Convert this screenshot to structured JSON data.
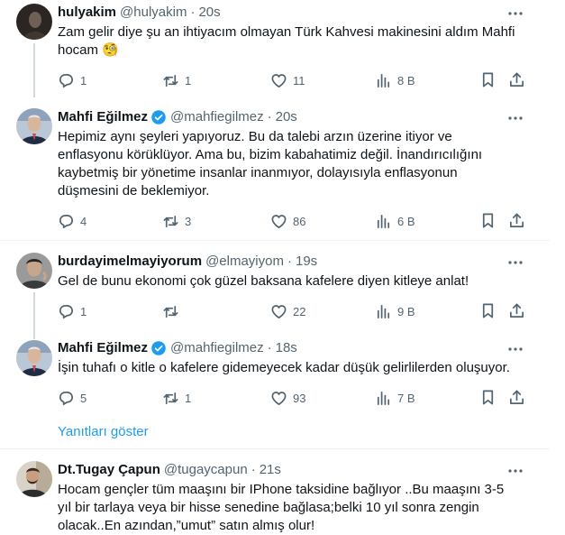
{
  "colors": {
    "accent": "#1d9bf0",
    "text": "#0f1419",
    "muted": "#536471",
    "divider": "#eff3f4"
  },
  "tweets": [
    {
      "name": "hulyakim",
      "handle": "@hulyakim",
      "dot": "·",
      "time": "20s",
      "verified": false,
      "text_lines": [
        "Zam gelir diye şu an ihtiyacım olmayan Türk Kahvesi makinesini aldım Mahfi",
        "hocam 🧐"
      ],
      "replies": "1",
      "retweets": "1",
      "likes": "11",
      "views": "8 B"
    },
    {
      "name": "Mahfi Eğilmez",
      "handle": "@mahfiegilmez",
      "dot": "·",
      "time": "20s",
      "verified": true,
      "text_lines": [
        "Hepimiz aynı şeyleri yapıyoruz. Bu da talebi arzın üzerine itiyor ve",
        "enflasyonu körüklüyor. Ama bu, bizim kabahatimiz değil. İnandırıcılığını",
        "kaybetmiş bir yönetime insanlar inanmıyor, dolayısıyla enflasyonun",
        "düşmesini de beklemiyor."
      ],
      "replies": "4",
      "retweets": "3",
      "likes": "86",
      "views": "6 B"
    },
    {
      "name": "burdayimelmayiyorum",
      "handle": "@elmayiyom",
      "dot": "·",
      "time": "19s",
      "verified": false,
      "text_lines": [
        "Gel de bunu ekonomi çok güzel baksana kafelere diyen kitleye anlat!"
      ],
      "replies": "1",
      "retweets": "",
      "likes": "22",
      "views": "9 B"
    },
    {
      "name": "Mahfi Eğilmez",
      "handle": "@mahfiegilmez",
      "dot": "·",
      "time": "18s",
      "verified": true,
      "text_lines": [
        "İşin tuhafı o kitle o kafelere gidemeyecek kadar düşük gelirlilerden oluşuyor."
      ],
      "replies": "5",
      "retweets": "1",
      "likes": "93",
      "views": "7 B"
    },
    {
      "name": "Dt.Tugay Çapun",
      "handle": "@tugaycapun",
      "dot": "·",
      "time": "21s",
      "verified": false,
      "text_lines": [
        "Hocam gençler tüm maaşını bir IPhone taksidine bağlıyor ..Bu maaşını 3-5",
        "yıl bir tarlaya veya bir hisse senedine bağlasa;belki 10 yıl sonra zengin",
        "olacak..En azından,”umut” satın almış olur!"
      ]
    }
  ],
  "show_replies": "Yanıtları göster"
}
